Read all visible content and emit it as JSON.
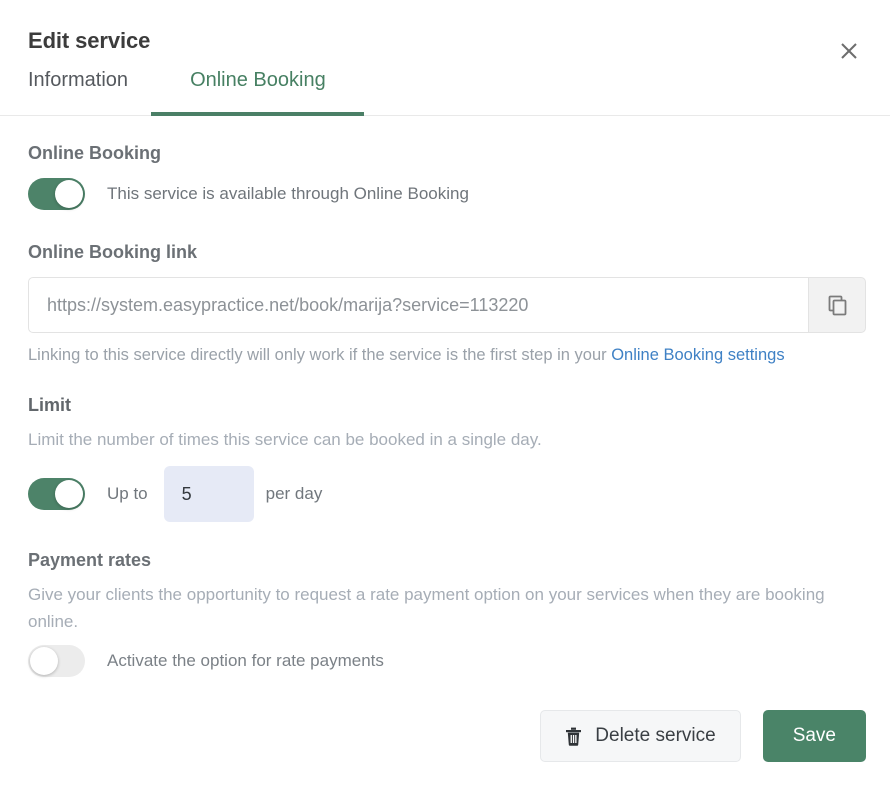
{
  "header": {
    "title": "Edit service",
    "close_icon": "close-icon"
  },
  "tabs": [
    {
      "label": "Information",
      "active": false
    },
    {
      "label": "Online Booking",
      "active": true
    }
  ],
  "online_booking": {
    "section_title": "Online Booking",
    "toggle_state": "on",
    "toggle_label": "This service is available through Online Booking"
  },
  "booking_link": {
    "section_title": "Online Booking link",
    "url_value": "https://system.easypractice.net/book/marija?service=113220",
    "url_placeholder": "https://system.easypractice.net/book/marija?service=113220",
    "copy_icon": "copy-icon",
    "helper_prefix": "Linking to this service directly will only work if the service is the first step in your ",
    "helper_link": "Online Booking settings"
  },
  "limit": {
    "section_title": "Limit",
    "description": "Limit the number of times this service can be booked in a single day.",
    "toggle_state": "on",
    "before_label": "Up to",
    "value": "5",
    "placeholder": "5",
    "after_label": "per day"
  },
  "payment_rates": {
    "section_title": "Payment rates",
    "description": "Give your clients the opportunity to request a rate payment option on your services when they are booking online.",
    "toggle_state": "off",
    "toggle_label": "Activate the option for rate payments"
  },
  "footer": {
    "delete_label": "Delete service",
    "delete_icon": "trash-icon",
    "save_label": "Save"
  },
  "colors": {
    "accent_green": "#4a8468",
    "toggle_green": "#4d8369",
    "link_blue": "#3f81c5",
    "input_focus_bg": "#e6eaf6"
  }
}
